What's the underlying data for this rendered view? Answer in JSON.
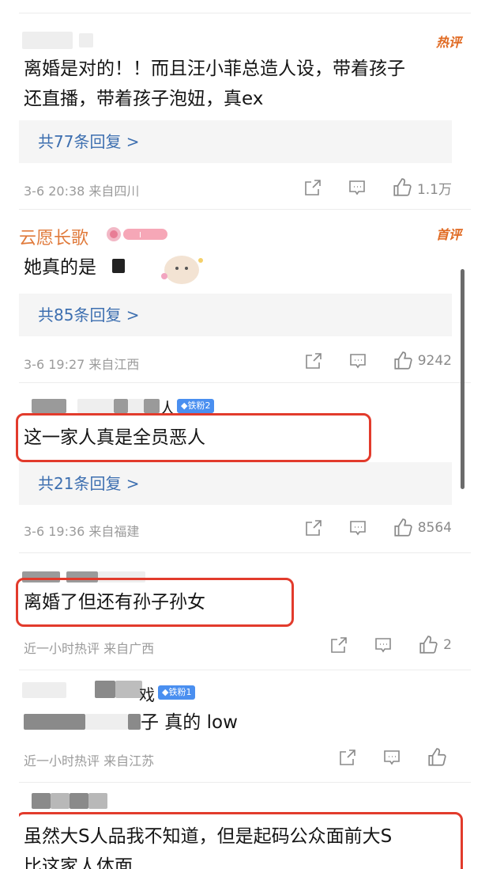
{
  "comments": [
    {
      "badge": "热评",
      "text_line1": "离婚是对的！！而且汪小菲总造人设，带着孩子",
      "text_line2": "还直播，带着孩子泡妞，真ex",
      "replies": "共77条回复 >",
      "meta": "3-6 20:38 来自四川",
      "likes": "1.1万"
    },
    {
      "username": "云愿长歌",
      "badge": "首评",
      "text": "她真的是",
      "replies": "共85条回复 >",
      "meta": "3-6 19:27 来自江西",
      "likes": "9242"
    },
    {
      "username_tail": "人",
      "fan_badge": "◆铁粉2",
      "text": "这一家人真是全员恶人",
      "replies": "共21条回复 >",
      "meta": "3-6 19:36 来自福建",
      "likes": "8564"
    },
    {
      "text": "离婚了但还有孙子孙女",
      "meta": "近一小时热评 来自广西",
      "likes": "2"
    },
    {
      "username_tail": "戏",
      "fan_badge": "◆铁粉1",
      "text": "子 真的 low",
      "meta": "近一小时热评 来自江苏",
      "likes": ""
    },
    {
      "text_line1": "虽然大S人品我不知道，但是起码公众面前大S",
      "text_line2": "比这家人体面"
    }
  ],
  "icons": {
    "share": "share-icon",
    "comment": "comment-icon",
    "like": "like-icon"
  },
  "colors": {
    "highlight": "#e23b2c",
    "reply_link": "#3d6fb0",
    "hot_badge": "#e06a22"
  }
}
